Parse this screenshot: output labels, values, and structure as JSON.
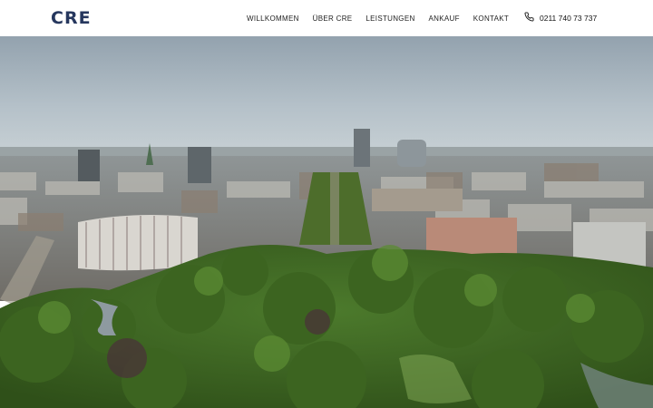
{
  "brand": {
    "logo_text": "CRE",
    "logo_color": "#26375e"
  },
  "nav": {
    "items": [
      {
        "label": "WILLKOMMEN"
      },
      {
        "label": "ÜBER CRE"
      },
      {
        "label": "LEISTUNGEN"
      },
      {
        "label": "ANKAUF"
      },
      {
        "label": "KONTAKT"
      }
    ]
  },
  "contact": {
    "phone": "0211 740 73 737",
    "icon": "phone-icon"
  },
  "hero": {
    "icon": "aerial-city-photo"
  }
}
